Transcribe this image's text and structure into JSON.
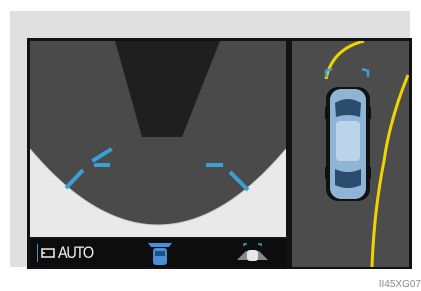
{
  "display": {
    "bottom_bar": {
      "mode_label": "AUTO",
      "camera_icon": "camera-icon",
      "car_icon": "car-front-icon",
      "view_switch_icon": "view-switch-icon"
    },
    "colors": {
      "guide_blue": "#3aa0d8",
      "guide_yellow": "#f0d400",
      "panel_gray": "#4a4a4a",
      "car_blue": "#8fb4d6"
    }
  },
  "caption": "II45XG07"
}
